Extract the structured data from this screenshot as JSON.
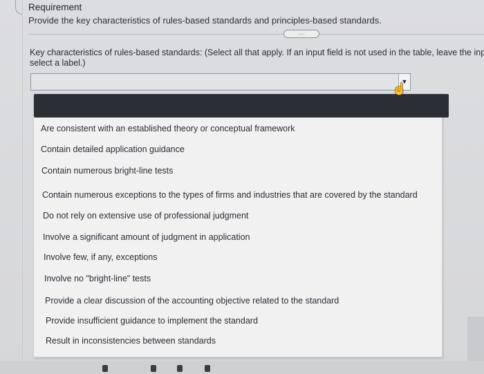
{
  "requirement": {
    "title": "Requirement",
    "text": "Provide the key characteristics of rules-based standards and principles-based standards.",
    "more_handle": "....."
  },
  "question": {
    "line1": "Key characteristics of rules-based standards: (Select all that apply. If an input field is not used in the table, leave the inpu",
    "line2": "select a label.)"
  },
  "select": {
    "value": "",
    "arrow": "▼"
  },
  "cursor": {
    "icon": "hand-pointer-icon",
    "glyph": "☝"
  },
  "dropdown": {
    "options": [
      "Are consistent with an established theory or conceptual framework",
      "Contain detailed application guidance",
      "Contain numerous bright-line tests",
      "Contain numerous exceptions to the types of firms and industries that are covered by the standard",
      "Do not rely on extensive use of professional judgment",
      "Involve a significant amount of judgment in application",
      "Involve few, if any, exceptions",
      "Involve no \"bright-line\" tests",
      "Provide a clear discussion of the accounting objective related to the standard",
      "Provide insufficient guidance to implement the standard",
      "Result in inconsistencies between standards"
    ]
  },
  "colors": {
    "dropdown_header": "#2b2e35",
    "select_border": "#8a9bb0",
    "background": "#d9dadc"
  }
}
